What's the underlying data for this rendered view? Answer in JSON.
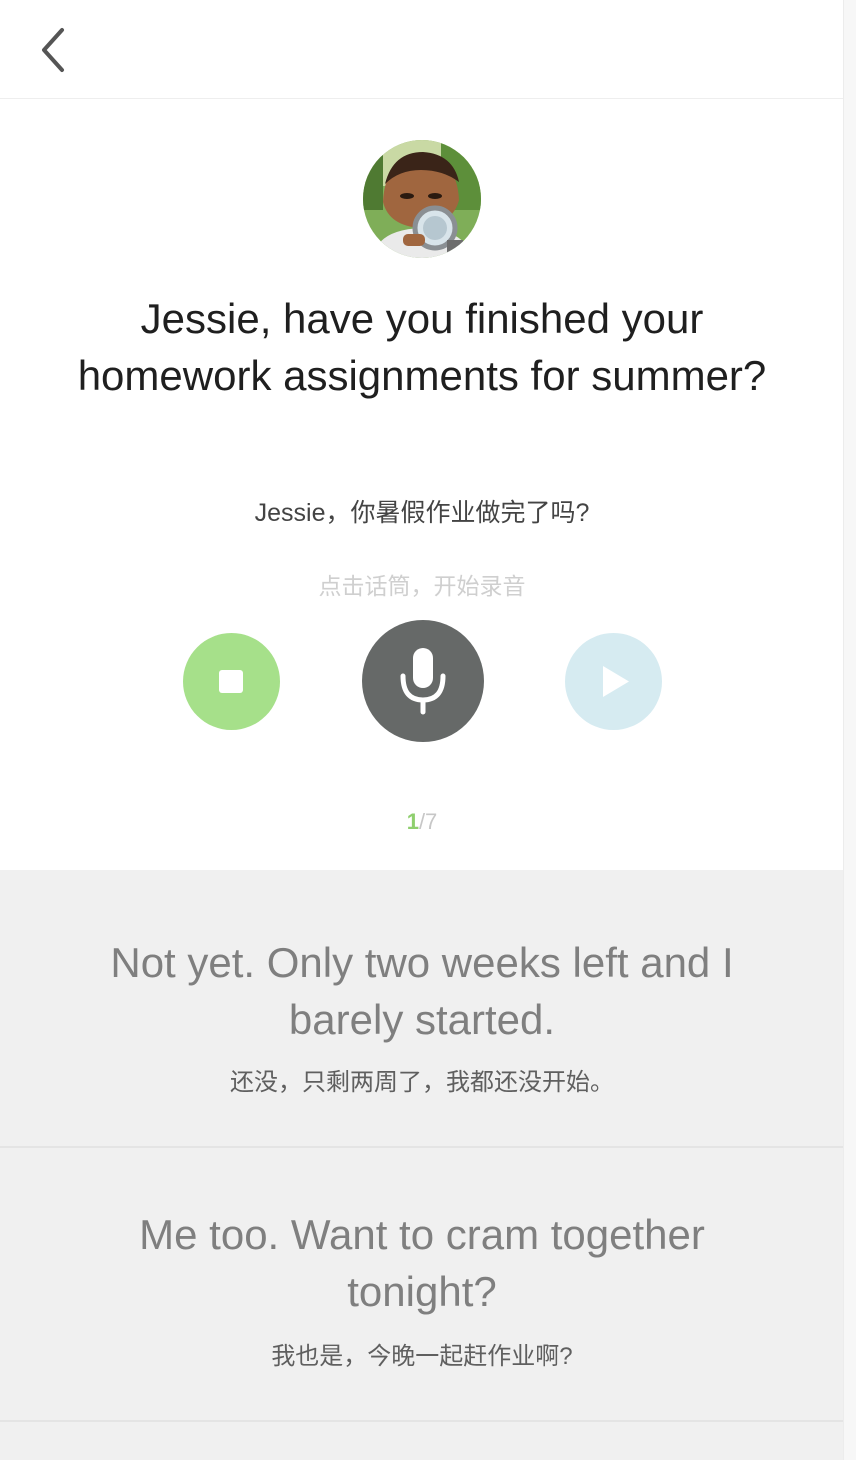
{
  "header": {
    "back_icon": "chevron-left-icon"
  },
  "speaker": {
    "avatar_icon": "child-with-magnifier-photo"
  },
  "prompt": {
    "english": "Jessie, have you finished your homework assignments for summer?",
    "chinese": "Jessie，你暑假作业做完了吗?"
  },
  "recorder": {
    "hint": "点击话筒，开始录音",
    "stop_icon": "stop-icon",
    "mic_icon": "microphone-icon",
    "play_icon": "play-icon"
  },
  "pagination": {
    "current": "1",
    "total": "/7"
  },
  "responses": [
    {
      "english": "Not yet. Only two weeks left and I barely started.",
      "chinese": "还没，只剩两周了，我都还没开始。"
    },
    {
      "english": "Me too. Want to cram together tonight?",
      "chinese": "我也是，今晚一起赶作业啊?"
    }
  ],
  "colors": {
    "stop_button": "#a6e08a",
    "mic_button": "#666968",
    "play_button": "#d6ebf1",
    "page_current": "#8fcf6e",
    "response_bg": "#f0f0f0"
  }
}
